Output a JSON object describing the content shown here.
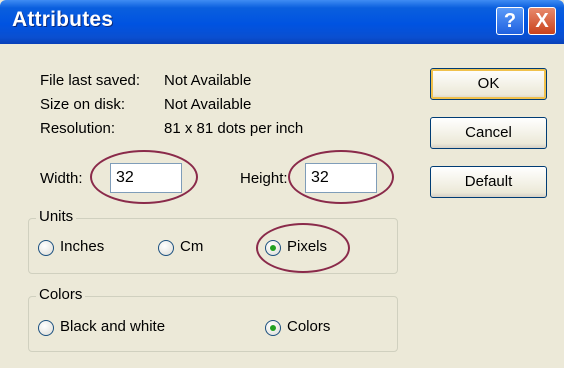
{
  "window": {
    "title": "Attributes",
    "help_glyph": "?",
    "close_glyph": "X"
  },
  "info": {
    "file_last_saved_label": "File last saved:",
    "file_last_saved_value": "Not Available",
    "size_on_disk_label": "Size on disk:",
    "size_on_disk_value": "Not Available",
    "resolution_label": "Resolution:",
    "resolution_value": "81 x 81 dots per inch"
  },
  "dimensions": {
    "width_label": "Width:",
    "width_value": "32",
    "height_label": "Height:",
    "height_value": "32"
  },
  "units": {
    "title": "Units",
    "options": [
      "Inches",
      "Cm",
      "Pixels"
    ],
    "selected": "Pixels"
  },
  "colors": {
    "title": "Colors",
    "options": [
      "Black and white",
      "Colors"
    ],
    "selected": "Colors"
  },
  "buttons": {
    "ok": "OK",
    "cancel": "Cancel",
    "default": "Default"
  },
  "theme": {
    "titlebar": "#0053e1",
    "dialog_bg": "#ece9d8",
    "annotation": "#8a2a4a",
    "radio_dot": "#21a121"
  }
}
